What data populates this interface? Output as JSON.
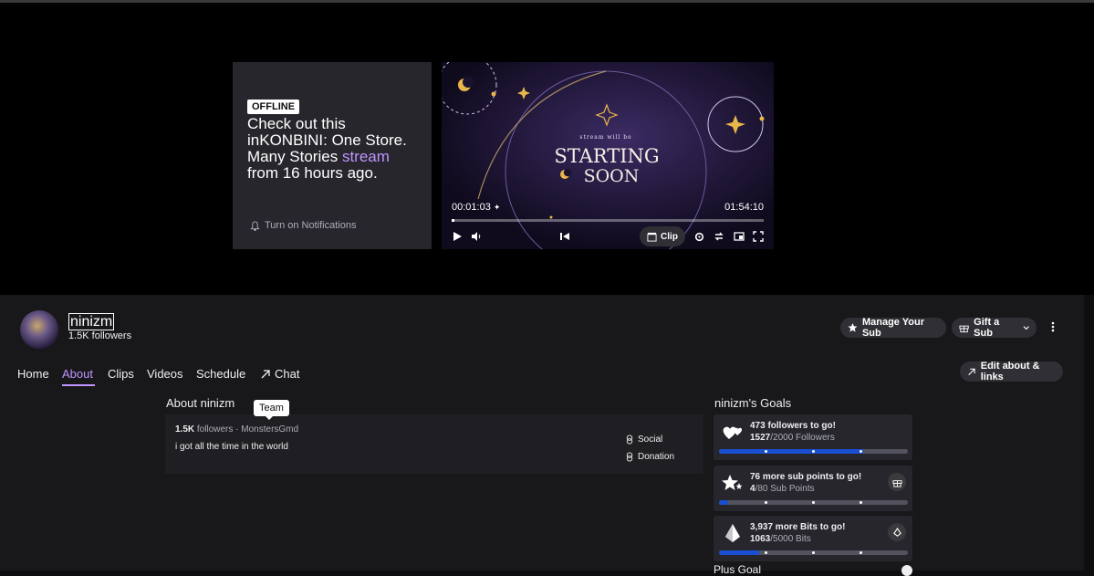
{
  "player": {
    "offline_badge": "OFFLINE",
    "offline_text_1": "Check out this inKONBINI: One Store. Many Stories",
    "offline_text_link": "stream",
    "offline_text_2": "from 16 hours ago.",
    "notify_label": "Turn on Notifications",
    "thumb_small": "stream will be",
    "thumb_line1": "STARTING",
    "thumb_line2": "SOON",
    "elapsed": "00:01:03",
    "duration": "01:54:10",
    "progress": 0.009,
    "clip_label": "Clip"
  },
  "channel": {
    "name": "ninizm",
    "followers": "1.5K followers",
    "manage_sub_label": "Manage Your Sub",
    "gift_sub_label": "Gift a Sub"
  },
  "nav": {
    "home": "Home",
    "about": "About",
    "clips": "Clips",
    "videos": "Videos",
    "schedule": "Schedule",
    "chat": "Chat",
    "edit_about": "Edit about & links"
  },
  "about": {
    "title": "About ninizm",
    "tooltip": "Team",
    "followers_count": "1.5K",
    "followers_word": "followers",
    "separator": "·",
    "team": "MonstersGmd",
    "bio": "i got all the time in the world",
    "links": [
      "Social",
      "Donation"
    ]
  },
  "goals": {
    "title": "ninizm's Goals",
    "items": [
      {
        "headline": "473 followers to go!",
        "current": "1527",
        "rest": "/2000 Followers",
        "progress": 0.7635,
        "icon": "hearts-icon"
      },
      {
        "headline": "76 more sub points to go!",
        "current": "4",
        "rest": "/80 Sub Points",
        "progress": 0.05,
        "icon": "stars-icon"
      },
      {
        "headline": "3,937 more Bits to go!",
        "current": "1063",
        "rest": "/5000 Bits",
        "progress": 0.2126,
        "icon": "bits-gem-icon"
      }
    ],
    "plus_goal": "Plus Goal"
  },
  "colors": {
    "accent": "#bf94ff",
    "progress": "#1b4fd1",
    "panel": "#18181b"
  }
}
